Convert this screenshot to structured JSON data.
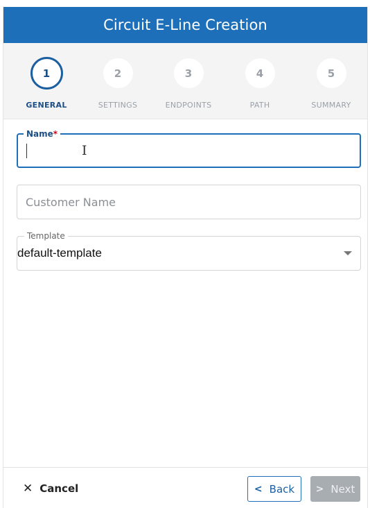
{
  "dialog": {
    "title": "Circuit E-Line Creation"
  },
  "stepper": {
    "steps": [
      {
        "number": "1",
        "label": "GENERAL",
        "active": true
      },
      {
        "number": "2",
        "label": "SETTINGS",
        "active": false
      },
      {
        "number": "3",
        "label": "ENDPOINTS",
        "active": false
      },
      {
        "number": "4",
        "label": "PATH",
        "active": false
      },
      {
        "number": "5",
        "label": "SUMMARY",
        "active": false
      }
    ]
  },
  "form": {
    "name": {
      "label": "Name",
      "required_marker": "*",
      "value": ""
    },
    "customer_name": {
      "placeholder": "Customer Name",
      "value": ""
    },
    "template": {
      "label": "Template",
      "value": "default-template"
    }
  },
  "footer": {
    "cancel_label": "Cancel",
    "back_label": "Back",
    "next_label": "Next"
  },
  "colors": {
    "header": "#1c6fb8",
    "active_step": "#1c4f86",
    "disabled_button": "#a8adb2"
  },
  "icons": {
    "cancel": "close-icon",
    "back": "chevron-left-icon",
    "next": "chevron-right-icon",
    "template": "caret-down-icon"
  }
}
